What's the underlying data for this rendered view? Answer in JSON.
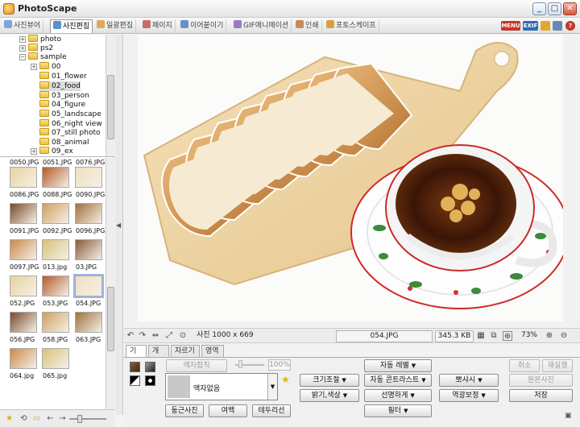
{
  "app": {
    "title": "PhotoScape"
  },
  "window_controls": {
    "minimize": "_",
    "maximize": "□",
    "close": "✕"
  },
  "tabs": [
    {
      "label": "사진뷰어",
      "icon": "viewer-icon",
      "active": false
    },
    {
      "label": "사진편집",
      "icon": "editor-icon",
      "active": true
    },
    {
      "label": "일괄편집",
      "icon": "batch-icon",
      "active": false
    },
    {
      "label": "페이지",
      "icon": "page-icon",
      "active": false
    },
    {
      "label": "이어붙이기",
      "icon": "combine-icon",
      "active": false
    },
    {
      "label": "GIF애니메이션",
      "icon": "gif-icon",
      "active": false
    },
    {
      "label": "인쇄",
      "icon": "print-icon",
      "active": false
    },
    {
      "label": "포토스케이프",
      "icon": "photoscape-icon",
      "active": false
    }
  ],
  "top_icons": {
    "menu": "MENU",
    "exif": "EXIF"
  },
  "folder_tree": [
    {
      "label": "photo",
      "level": 1,
      "expander": "+"
    },
    {
      "label": "ps2",
      "level": 1,
      "expander": "+"
    },
    {
      "label": "sample",
      "level": 1,
      "expander": "−"
    },
    {
      "label": "00",
      "level": 2,
      "expander": "+"
    },
    {
      "label": "01_flower",
      "level": 2,
      "expander": ""
    },
    {
      "label": "02_food",
      "level": 2,
      "expander": "",
      "selected": true
    },
    {
      "label": "03_person",
      "level": 2,
      "expander": ""
    },
    {
      "label": "04_figure",
      "level": 2,
      "expander": ""
    },
    {
      "label": "05_landscape",
      "level": 2,
      "expander": ""
    },
    {
      "label": "06_night view",
      "level": 2,
      "expander": ""
    },
    {
      "label": "07_still photo",
      "level": 2,
      "expander": ""
    },
    {
      "label": "08_animal",
      "level": 2,
      "expander": ""
    },
    {
      "label": "09_ex",
      "level": 2,
      "expander": "+"
    }
  ],
  "thumbnail_rows": [
    [
      "0050.JPG",
      "0051.JPG",
      "0076.JPG"
    ],
    [
      "0086.JPG",
      "0088.JPG",
      "0090.JPG"
    ],
    [
      "0091.JPG",
      "0092.JPG",
      "0096.JPG"
    ],
    [
      "0097.JPG",
      "013.jpg",
      "03.JPG"
    ],
    [
      "052.JPG",
      "053.JPG",
      "054.JPG"
    ],
    [
      "056.JPG",
      "058.JPG",
      "063.JPG"
    ],
    [
      "064.jpg",
      "065.jpg",
      ""
    ]
  ],
  "selected_thumbnail": "054.JPG",
  "image_bar": {
    "size": "사진 1000 x 669",
    "filename": "054.JPG",
    "filesize": "345.3 KB",
    "zoom": "73%"
  },
  "edit_tabs": [
    {
      "label": "기본",
      "active": true
    },
    {
      "label": "개체",
      "active": false
    },
    {
      "label": "자르기",
      "active": false
    },
    {
      "label": "영역",
      "active": false
    }
  ],
  "frame": {
    "merge_button": "액자합칙",
    "percent": "100%",
    "selected": "액자없음"
  },
  "bottom_buttons": {
    "rounded": "둥근사진",
    "margin": "여백",
    "border": "테두리선"
  },
  "adjust_buttons": {
    "resize": "크기조절",
    "brightness": "밝기,색상",
    "auto_level": "자동 레벨",
    "auto_contrast": "자동 콘트라스트",
    "sharpen": "선명하게",
    "filter": "필터",
    "backlight": "뽀샤시",
    "backlight_fix": "역광보정"
  },
  "action_buttons": {
    "undo": "취소",
    "redo": "재실행",
    "original": "원본사진",
    "save": "저장"
  },
  "colors": {
    "accent": "#9cb6e6",
    "menu_icon": "#c0392b",
    "exif_icon": "#2c6fb3"
  }
}
